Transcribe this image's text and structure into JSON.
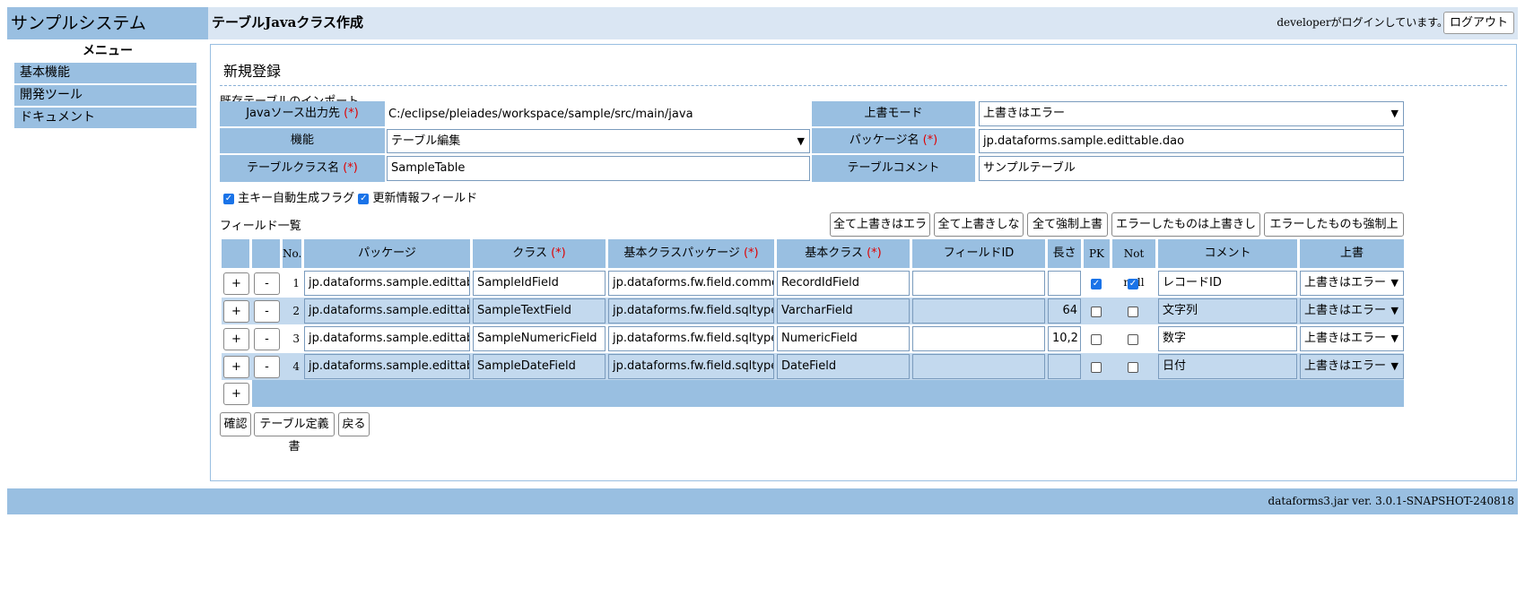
{
  "header": {
    "system_title": "サンプルシステム",
    "page_title": "テーブルJavaクラス作成",
    "login_text": "developerがログインしています。",
    "logout_label": "ログアウト"
  },
  "sidebar": {
    "menu_title": "メニュー",
    "items": [
      {
        "label": "基本機能"
      },
      {
        "label": "開発ツール"
      },
      {
        "label": "ドキュメント"
      }
    ]
  },
  "form": {
    "section_title": "新規登録",
    "import_link": "既存テーブルのインポート...",
    "required_mark": "(*)",
    "java_src_label": "Javaソース出力先",
    "java_src_value": "C:/eclipse/pleiades/workspace/sample/src/main/java",
    "overwrite_mode_label": "上書モード",
    "overwrite_mode_value": "上書きはエラー",
    "function_label": "機能",
    "function_value": "テーブル編集",
    "package_label": "パッケージ名",
    "package_value": "jp.dataforms.sample.edittable.dao",
    "table_class_label": "テーブルクラス名",
    "table_class_value": "SampleTable",
    "table_comment_label": "テーブルコメント",
    "table_comment_value": "サンプルテーブル",
    "auto_pk_label": "主キー自動生成フラグ",
    "auto_pk_checked": true,
    "update_info_label": "更新情報フィールド",
    "update_info_checked": true
  },
  "fields": {
    "title": "フィールド一覧",
    "bulk_buttons": [
      "全て上書きはエラー",
      "全て上書きしない",
      "全て強制上書き",
      "エラーしたものは上書きしない",
      "エラーしたものも強制上書き"
    ],
    "columns": {
      "no": "No.",
      "package": "パッケージ",
      "class": "クラス",
      "base_package": "基本クラスパッケージ",
      "base_class": "基本クラス",
      "field_id": "フィールドID",
      "length": "長さ",
      "pk": "PK",
      "not_null": "Not null",
      "comment": "コメント",
      "overwrite": "上書"
    },
    "add_label": "+",
    "remove_label": "-",
    "rows": [
      {
        "no": "1",
        "package": "jp.dataforms.sample.edittable.fiel",
        "class": "SampleIdField",
        "base_package": "jp.dataforms.fw.field.common",
        "base_class": "RecordIdField",
        "field_id": "",
        "length": "",
        "pk": true,
        "not_null": true,
        "comment": "レコードID",
        "overwrite": "上書きはエラー"
      },
      {
        "no": "2",
        "package": "jp.dataforms.sample.edittable.fiel",
        "class": "SampleTextField",
        "base_package": "jp.dataforms.fw.field.sqltype",
        "base_class": "VarcharField",
        "field_id": "",
        "length": "64",
        "pk": false,
        "not_null": false,
        "comment": "文字列",
        "overwrite": "上書きはエラー"
      },
      {
        "no": "3",
        "package": "jp.dataforms.sample.edittable.fiel",
        "class": "SampleNumericField",
        "base_package": "jp.dataforms.fw.field.sqltype",
        "base_class": "NumericField",
        "field_id": "",
        "length": "10,2",
        "pk": false,
        "not_null": false,
        "comment": "数字",
        "overwrite": "上書きはエラー"
      },
      {
        "no": "4",
        "package": "jp.dataforms.sample.edittable.fiel",
        "class": "SampleDateField",
        "base_package": "jp.dataforms.fw.field.sqltype",
        "base_class": "DateField",
        "field_id": "",
        "length": "",
        "pk": false,
        "not_null": false,
        "comment": "日付",
        "overwrite": "上書きはエラー"
      }
    ]
  },
  "actions": {
    "confirm": "確認",
    "table_def": "テーブル定義書",
    "back": "戻る"
  },
  "footer": {
    "version": "dataforms3.jar ver. 3.0.1-SNAPSHOT-240818"
  },
  "colors": {
    "header_bg": "#dae6f3",
    "accent": "#99bfe1",
    "row_alt": "#c3d9ee",
    "required": "#e00000",
    "checkbox": "#1a73e8"
  }
}
